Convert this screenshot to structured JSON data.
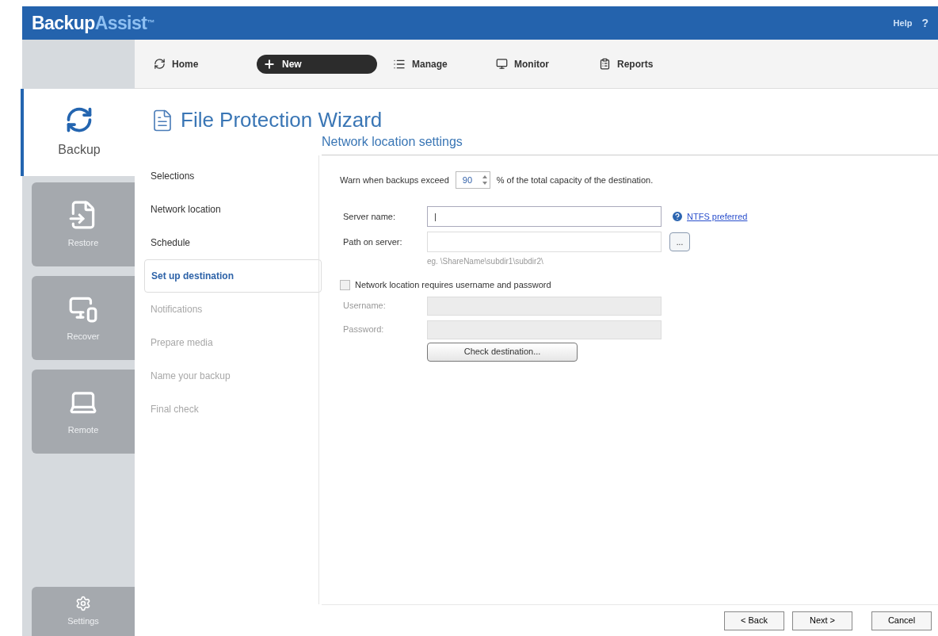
{
  "brand": {
    "primary": "Backup",
    "secondary": "Assist",
    "mark": "™"
  },
  "help": {
    "label": "Help",
    "icon_text": "?"
  },
  "nav": [
    {
      "label": "Home",
      "kind": "home",
      "selected": false
    },
    {
      "label": "New",
      "kind": "new",
      "selected": true
    },
    {
      "label": "Manage",
      "kind": "manage",
      "selected": false
    },
    {
      "label": "Monitor",
      "kind": "monitor",
      "selected": false
    },
    {
      "label": "Reports",
      "kind": "reports",
      "selected": false
    }
  ],
  "sidebar": [
    {
      "label": "Backup",
      "kind": "backup",
      "selected": true
    },
    {
      "label": "Restore",
      "kind": "restore",
      "selected": false
    },
    {
      "label": "Recover",
      "kind": "recover",
      "selected": false
    },
    {
      "label": "Remote",
      "kind": "remote",
      "selected": false
    }
  ],
  "settings": {
    "label": "Settings"
  },
  "wizard_title": "File Protection Wizard",
  "steps": [
    {
      "label": "Selections",
      "selected": false,
      "disabled": false
    },
    {
      "label": "Network location",
      "selected": false,
      "disabled": false
    },
    {
      "label": "Schedule",
      "selected": false,
      "disabled": false
    },
    {
      "label": "Set up destination",
      "selected": true,
      "disabled": false
    },
    {
      "label": "Notifications",
      "selected": false,
      "disabled": true
    },
    {
      "label": "Prepare media",
      "selected": false,
      "disabled": true
    },
    {
      "label": "Name your backup",
      "selected": false,
      "disabled": true
    },
    {
      "label": "Final check",
      "selected": false,
      "disabled": true
    }
  ],
  "section_title": "Network location settings",
  "warn": {
    "before": "Warn when backups exceed",
    "value": "90",
    "after": "% of the total capacity of the destination."
  },
  "server_name": {
    "label": "Server name:",
    "value": "|"
  },
  "ntfs_link": "NTFS preferred",
  "path": {
    "label": "Path on server:",
    "browse": "...",
    "hint": "eg. \\ShareName\\subdir1\\subdir2\\"
  },
  "credentials": {
    "label": "Network location requires username and password",
    "checked": false
  },
  "username": {
    "label": "Username:",
    "disabled": true
  },
  "password": {
    "label": "Password:",
    "disabled": true
  },
  "check_button": "Check destination...",
  "buttons": [
    "< Back",
    "Next >",
    "Cancel"
  ]
}
